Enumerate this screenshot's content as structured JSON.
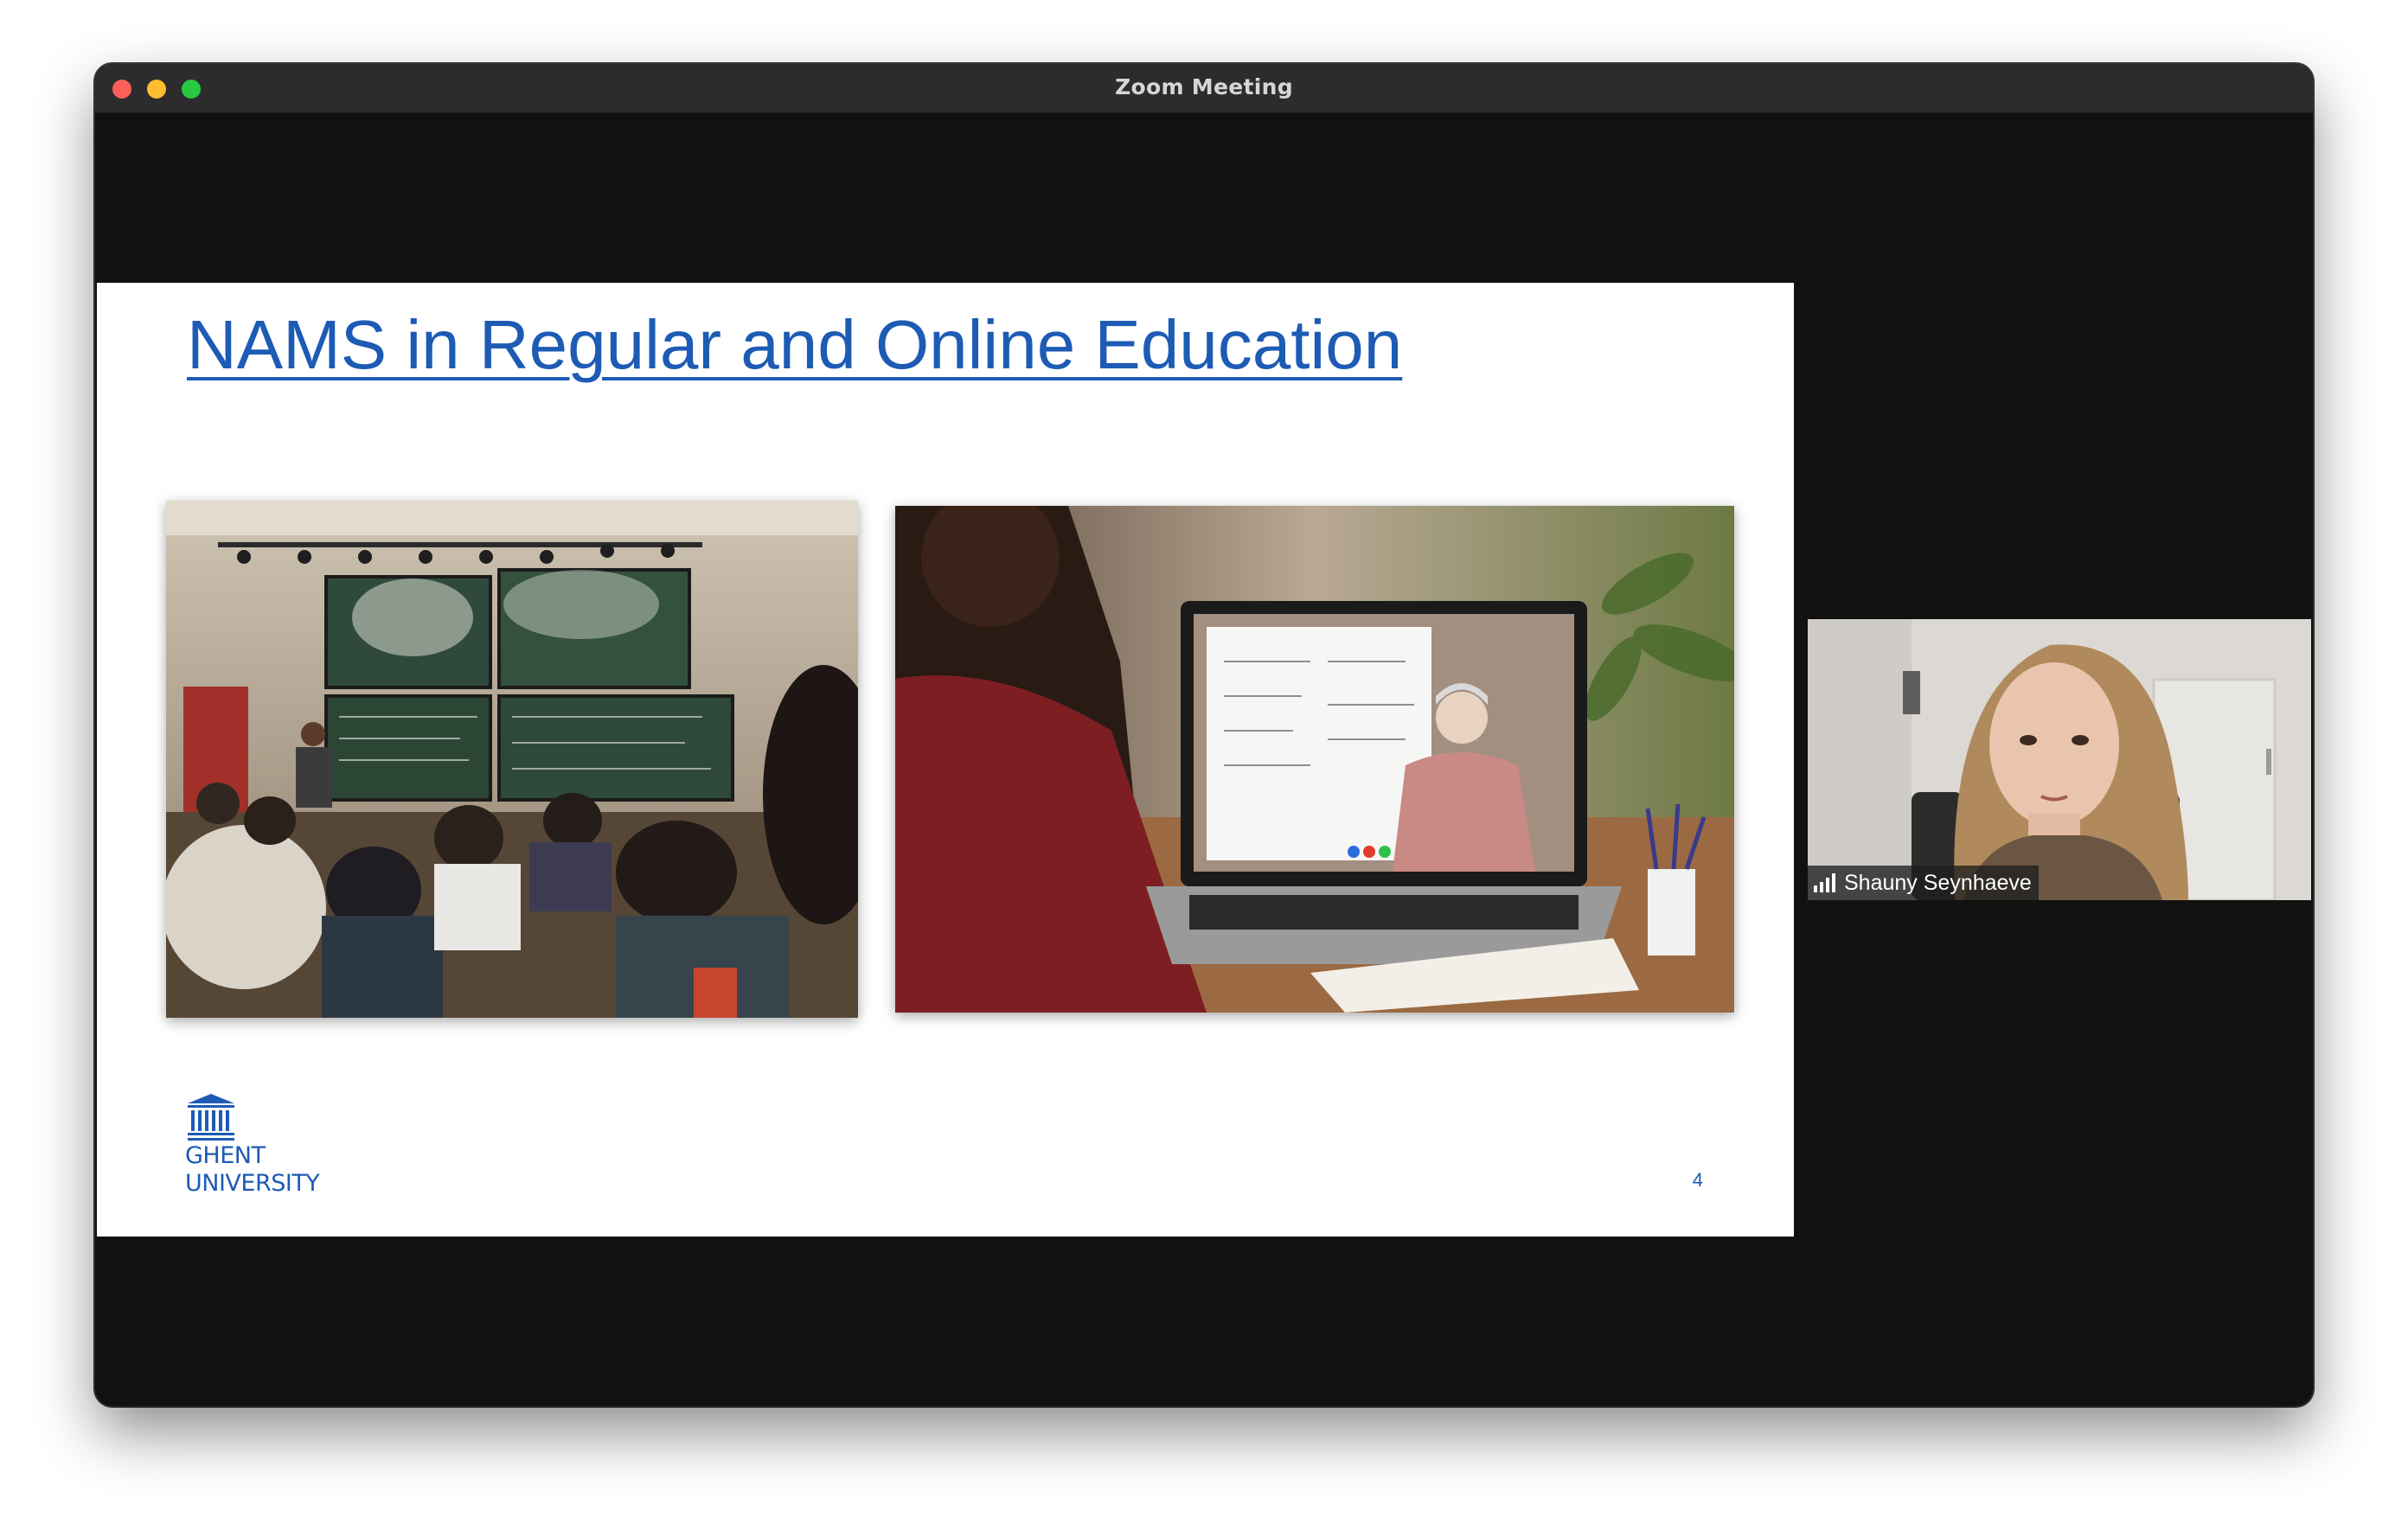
{
  "window": {
    "title": "Zoom Meeting"
  },
  "slide": {
    "title": "NAMS in Regular and Online Education",
    "logo": {
      "line1": "GHENT",
      "line2": "UNIVERSITY"
    },
    "page_number": "4",
    "images": [
      {
        "alt": "Lecture hall with students facing chalkboards"
      },
      {
        "alt": "Student watching teacher on laptop video call"
      }
    ]
  },
  "participant": {
    "name": "Shauny Seynhaeve",
    "icon": "signal-bars-icon"
  }
}
